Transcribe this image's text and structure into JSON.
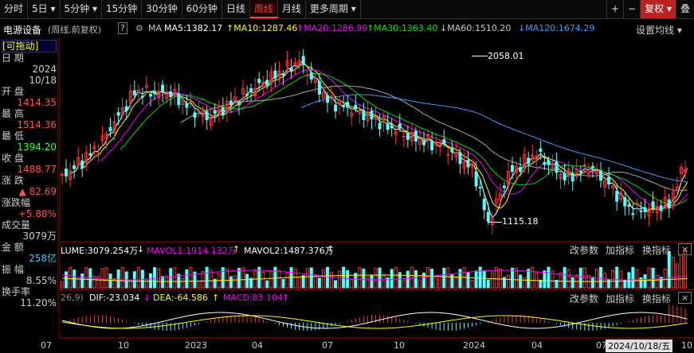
{
  "toolbar": {
    "tabs": [
      "分时",
      "5日",
      "5分钟",
      "15分钟",
      "30分钟",
      "60分钟",
      "日线",
      "周线",
      "月线",
      "更多周期"
    ],
    "active": "周线",
    "plus": "+",
    "minus": "−",
    "fq": "复权",
    "right_cut": "叠"
  },
  "info": {
    "name": "电源设备",
    "mode": "(周线,前复权)",
    "help": "?",
    "ma_label": "MA",
    "ma5": "MA5:1382.17",
    "ma10": "MA10:1287.46",
    "ma20": "MA20:1286.99",
    "ma30": "MA30:1363.40",
    "ma60": "MA60:1510.20",
    "ma120": "MA120:1674.29",
    "settings": "设置均线"
  },
  "left": {
    "drag": "[可拖动]",
    "date_lbl": "日 期",
    "year": "2024",
    "date": "10/18",
    "open_lbl": "开 盘",
    "open": "1414.35",
    "high_lbl": "最 高",
    "high": "1514.36",
    "low_lbl": "最 低",
    "low": "1394.20",
    "close_lbl": "收 盘",
    "close": "1488.77",
    "chg_lbl": "涨 跌",
    "chg": "▲ 82.69",
    "pct_lbl": "涨跌幅",
    "pct": "+5.88%",
    "vol_lbl": "成交量",
    "vol": "3079万",
    "amt_lbl": "金 额",
    "amt": "258亿",
    "amp_lbl": "振 幅",
    "amp": "8.55%",
    "turn_lbl": "换手率",
    "turn": "11.20%"
  },
  "annot": {
    "high": "2058.01",
    "low": "1115.18"
  },
  "vol_panel": {
    "v": "LUME:3079.254万",
    "mavol1": "MAVOL1:1914.132万",
    "mavol2": "MAVOL2:1487.376万",
    "tools": [
      "改参数",
      "加指标",
      "换指标"
    ],
    "close": "×"
  },
  "macd_panel": {
    "head": "26,9)",
    "dif": "DIF:-23.034",
    "dea": "DEA:-64.586",
    "macd": "MACD:83.104",
    "tools": [
      "改参数",
      "加指标",
      "换指标"
    ],
    "close": "×"
  },
  "xaxis": [
    "07",
    "10",
    "2023",
    "04",
    "07",
    "10",
    "2024",
    "04",
    "07",
    "10"
  ],
  "cursor_date": "2024/10/18/五",
  "colors": {
    "up": "#ff3232",
    "down": "#54ffff",
    "ma5": "#ffffff",
    "ma10": "#ffff00",
    "ma20": "#ff00ff",
    "ma30": "#00e000",
    "ma60": "#aaaaaa",
    "ma120": "#3aa0ff"
  },
  "chart_data": {
    "type": "candlestick",
    "period": "weekly",
    "symbol": "电源设备",
    "annotated_high": 2058.01,
    "annotated_low": 1115.18,
    "last_bar": {
      "date": "2024/10/18",
      "open": 1414.35,
      "high": 1514.36,
      "low": 1394.2,
      "close": 1488.77,
      "change": 82.69,
      "pct": "+5.88%",
      "volume": "3079万",
      "amount": "258亿"
    },
    "ma": {
      "MA5": 1382.17,
      "MA10": 1287.46,
      "MA20": 1286.99,
      "MA30": 1363.4,
      "MA60": 1510.2,
      "MA120": 1674.29
    },
    "volume": {
      "VOLUME": "3079.254万",
      "MAVOL1": "1914.132万",
      "MAVOL2": "1487.376万"
    },
    "macd": {
      "DIF": -23.034,
      "DEA": -64.586,
      "MACD": 83.104
    },
    "x_ticks": [
      "07",
      "10",
      "2023",
      "04",
      "07",
      "10",
      "2024",
      "04",
      "07",
      "10"
    ]
  }
}
